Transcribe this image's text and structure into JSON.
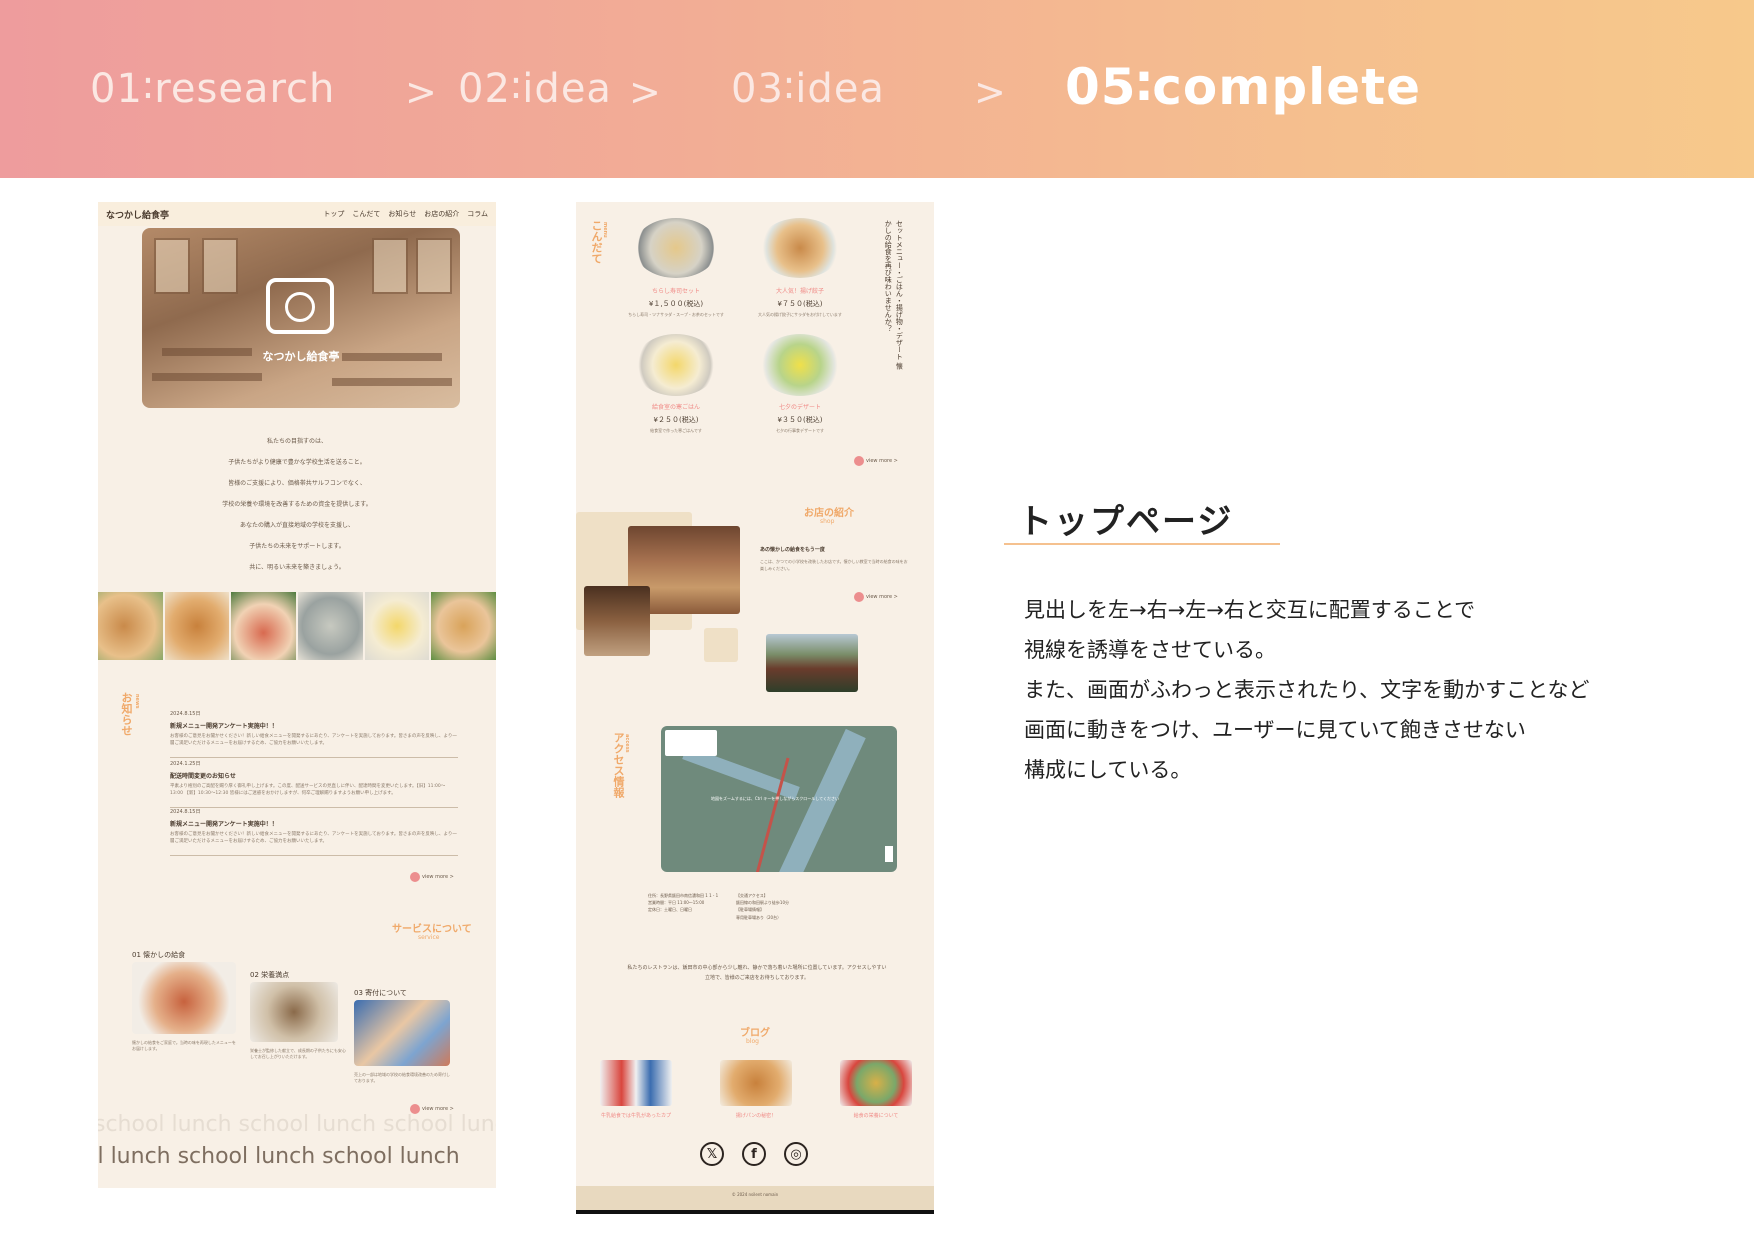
{
  "header": {
    "steps": [
      {
        "label": "01∶research"
      },
      {
        "label": "02∶idea"
      },
      {
        "label": "03∶idea"
      },
      {
        "label": "05∶complete"
      }
    ],
    "separator": ">"
  },
  "mock_top": {
    "logo": "なつかし給食亭",
    "nav": [
      "トップ",
      "こんだて",
      "お知らせ",
      "お店の紹介",
      "コラム"
    ],
    "hero_title": "なつかし給食亭",
    "intro_lines": [
      "私たちの目指すのは、",
      "子供たちがより健康で豊かな学校生活を送ること。",
      "皆様のご支援により、価格帯共サルフコンでなく、",
      "学校の栄養や環境を改善するための資金を提供します。",
      "あなたの購入が直接地域の学校を支援し、",
      "子供たちの未来をサポートします。",
      "共に、明るい未来を築きましょう。"
    ],
    "news_label": "お知らせ",
    "news_label_en": "news",
    "news": [
      {
        "date": "2024.8.15日",
        "title": "新規メニュー開発アンケート実施中！！",
        "body": "お客様のご意見をお聞かせください！新しい給食メニューを開発するにあたり、アンケートを実施しております。皆さまの声を反映し、より一層ご満足いただけるメニューをお届けするため、ご協力をお願いいたします。"
      },
      {
        "date": "2024.1.25日",
        "title": "配送時間変更のお知らせ",
        "body": "平素より格別のご高配を賜り厚く御礼申し上げます。この度、配送サービスの見直しに伴い、配達時間を変更いたします。【旧】11:00〜13:00 【新】10:30〜12:30 皆様にはご迷惑をおかけしますが、何卒ご理解賜りますようお願い申し上げます。"
      },
      {
        "date": "2024.8.15日",
        "title": "新規メニュー開発アンケート実施中！！",
        "body": "お客様のご意見をお聞かせください！新しい給食メニューを開発するにあたり、アンケートを実施しております。皆さまの声を反映し、より一層ご満足いただけるメニューをお届けするため、ご協力をお願いいたします。"
      }
    ],
    "view_more": "view more >",
    "service_title": "サービスについて",
    "service_sub": "service",
    "services": [
      {
        "label": "01 懐かしの給食",
        "text": "懐かしの給食をご家庭で。当時の味を再現したメニューをお届けします。"
      },
      {
        "label": "02 栄養満点",
        "text": "栄養士が監修した献立で、成長期の子供たちにも安心してお召し上がりいただけます。"
      },
      {
        "label": "03 寄付について",
        "text": "売上の一部は地域の学校の給食環境改善のため寄付しております。"
      }
    ],
    "scroll_text": "school lunch school lunch school lunch",
    "scroll_text2": "ol lunch school lunch school lunch"
  },
  "mock_menu": {
    "menu_label": "こんだて",
    "menu_label_en": "menu",
    "dishes": [
      {
        "name": "ちらし寿司セット",
        "price": "¥１,５００(税込)",
        "desc": "ちらし寿司・ツナサラダ・スープ・お茶のセットです"
      },
      {
        "name": "大人気！揚げ餃子",
        "price": "¥７５０(税込)",
        "desc": "大人気の揚げ餃子にサラダをお付けしています"
      },
      {
        "name": "給食室の寒ごはん",
        "price": "¥２５０(税込)",
        "desc": "給食室で作った寒ごはんです"
      },
      {
        "name": "七夕のデザート",
        "price": "¥３５０(税込)",
        "desc": "七夕の行事食デザートです"
      }
    ],
    "vertical_copy": "セットメニュー・ごはん・揚げ物・デザート 懐かしの給食を再び味わいませんか？",
    "view_more": "view more >",
    "shop_label": "お店の紹介",
    "shop_label_en": "shop",
    "shop_title": "あの懐かしの給食をもう一度",
    "shop_text": "ここは、かつての小学校を改装したお店です。懐かしい教室で当時の給食の味をお楽しみください。",
    "access_label": "アクセス情報",
    "access_label_en": "access",
    "map_caption": "地図をズームするには、Ctrl キーを押しながらスクロールしてください",
    "access_info_left": [
      "住所：長野県飯田市南信濃和田 1 1 - 1",
      "営業時間：平日 11:00〜15:00",
      "定休日：土曜日、日曜日"
    ],
    "access_info_right": [
      "【交通アクセス】",
      "飯田線の和田駅より徒歩10分",
      "【駐車場情報】",
      "専用駐車場あり（20台）"
    ],
    "access_text": "私たちのレストランは、飯田市の中心部から少し離れ、静かで落ち着いた場所に位置しています。アクセスしやすい立地で、皆様のご来店をお待ちしております。",
    "blog_label": "ブログ",
    "blog_label_en": "blog",
    "blogs": [
      {
        "caption": "牛乳給食では牛乳があったカプ"
      },
      {
        "caption": "揚げパンの秘密！"
      },
      {
        "caption": "給食の栄養について"
      }
    ],
    "sns": [
      "𝕏",
      "f",
      "◎"
    ],
    "footer": "© 2024 nsilent nomain"
  },
  "description": {
    "heading": "トップページ",
    "lines": [
      "見出しを左→右→左→右と交互に配置することで",
      "視線を誘導をさせている。",
      "また、画面がふわっと表示されたり、文字を動かすことなど",
      "画面に動きをつけ、ユーザーに見ていて飽きさせない",
      "構成にしている。"
    ]
  },
  "colors": {
    "accent": "#f0a96a",
    "pink": "#ec8e8e",
    "bg": "#f8f0e6"
  }
}
